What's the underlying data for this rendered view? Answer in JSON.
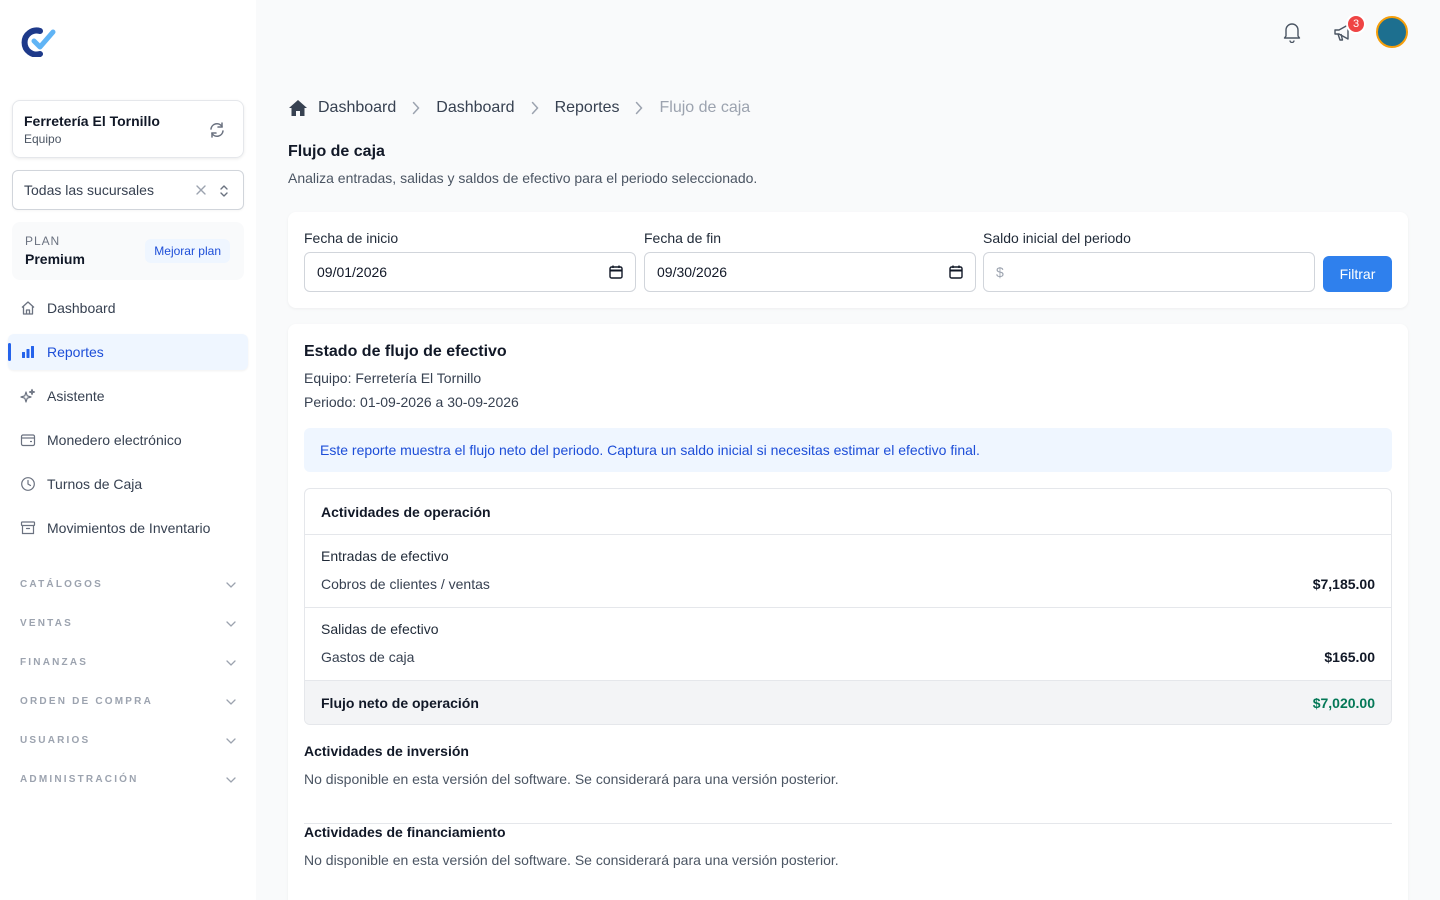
{
  "sidebar": {
    "team": {
      "name": "Ferretería El Tornillo",
      "sub": "Equipo"
    },
    "branch_select": {
      "value": "Todas las sucursales"
    },
    "plan": {
      "label": "PLAN",
      "name": "Premium",
      "upgrade_label": "Mejorar plan"
    },
    "nav": [
      {
        "label": "Dashboard",
        "icon": "home-icon"
      },
      {
        "label": "Reportes",
        "icon": "bar-chart-icon",
        "active": true
      },
      {
        "label": "Asistente",
        "icon": "sparkles-icon"
      },
      {
        "label": "Monedero electrónico",
        "icon": "wallet-icon"
      },
      {
        "label": "Turnos de Caja",
        "icon": "clock-icon"
      },
      {
        "label": "Movimientos de Inventario",
        "icon": "archive-icon"
      }
    ],
    "sections": [
      "CATÁLOGOS",
      "VENTAS",
      "FINANZAS",
      "ORDEN DE COMPRA",
      "USUARIOS",
      "ADMINISTRACIÓN"
    ]
  },
  "topbar": {
    "notification_badge": "3"
  },
  "breadcrumb": [
    "Dashboard",
    "Dashboard",
    "Reportes",
    "Flujo de caja"
  ],
  "page": {
    "title": "Flujo de caja",
    "subtitle": "Analiza entradas, salidas y saldos de efectivo para el periodo seleccionado."
  },
  "filters": {
    "start_label": "Fecha de inicio",
    "start_value": "09/01/2026",
    "end_label": "Fecha de fin",
    "end_value": "09/30/2026",
    "balance_label": "Saldo inicial del periodo",
    "balance_prefix": "$",
    "button_label": "Filtrar"
  },
  "report": {
    "title": "Estado de flujo de efectivo",
    "team": "Equipo: Ferretería El Tornillo",
    "period": "Periodo: 01-09-2026 a 30-09-2026",
    "info": "Este reporte muestra el flujo neto del periodo. Captura un saldo inicial si necesitas estimar el efectivo final.",
    "operations": {
      "title": "Actividades de operación",
      "inflows": {
        "category": "Entradas de efectivo",
        "label": "Cobros de clientes / ventas",
        "amount": "$7,185.00"
      },
      "outflows": {
        "category": "Salidas de efectivo",
        "label": "Gastos de caja",
        "amount": "$165.00"
      },
      "net": {
        "label": "Flujo neto de operación",
        "amount": "$7,020.00"
      }
    },
    "investment": {
      "title": "Actividades de inversión",
      "desc": "No disponible en esta versión del software. Se considerará para una versión posterior."
    },
    "financing": {
      "title": "Actividades de financiamiento",
      "desc": "No disponible en esta versión del software. Se considerará para una versión posterior."
    }
  },
  "colors": {
    "accent": "#2f80ed",
    "active_nav": "#1d4ed8",
    "positive": "#047857",
    "badge": "#ef4444"
  }
}
